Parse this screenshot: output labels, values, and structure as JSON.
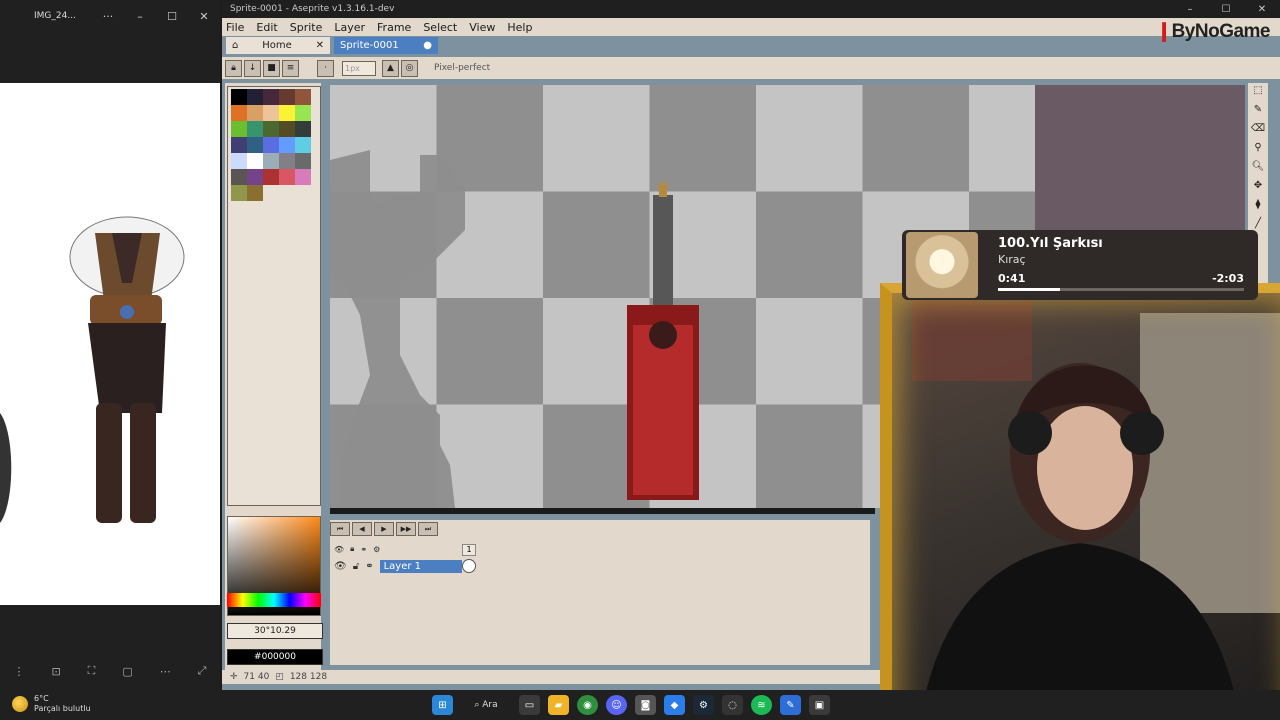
{
  "viewer": {
    "title": "IMG_24...",
    "more": "···",
    "minimize": "–",
    "maximize": "☐",
    "close": "✕"
  },
  "aseprite": {
    "title": "Sprite-0001 - Aseprite v1.3.16.1-dev",
    "menu": [
      "File",
      "Edit",
      "Sprite",
      "Layer",
      "Frame",
      "Select",
      "View",
      "Help"
    ],
    "brand": "ByNoGame",
    "tabs": {
      "home": "Home",
      "home_close": "✕",
      "sprite": "Sprite-0001",
      "sprite_dot": "●"
    },
    "toolbar": {
      "brush_size": "1px",
      "pixel_perfect": "Pixel-perfect"
    },
    "color_fields": {
      "hsv": "30°10.29",
      "hex": "#000000",
      "warn": "!"
    },
    "status": {
      "cursor": "71 40",
      "size": "128 128"
    },
    "timeline": {
      "layer_name": "Layer 1",
      "frame_num": "1"
    },
    "palette_colors": [
      "#000000",
      "#222034",
      "#45283c",
      "#663931",
      "#8f563b",
      "#df7126",
      "#d9a066",
      "#eec39a",
      "#fbf236",
      "#99e550",
      "#6abe30",
      "#37946e",
      "#4b692f",
      "#524b24",
      "#323c39",
      "#3f3f74",
      "#306082",
      "#5b6ee1",
      "#639bff",
      "#5fcde4",
      "#cbdbfc",
      "#ffffff",
      "#9badb7",
      "#847e87",
      "#696a6a",
      "#595652",
      "#76428a",
      "#ac3232",
      "#d95763",
      "#d77bba",
      "#8f974a",
      "#8a6f30"
    ]
  },
  "music": {
    "title": "100.Yıl Şarkısı",
    "artist": "Kıraç",
    "current": "0:41",
    "remaining": "-2:03",
    "progress": 0.25
  },
  "taskbar": {
    "temp": "6°C",
    "weather": "Parçalı bulutlu",
    "search": "Ara"
  }
}
